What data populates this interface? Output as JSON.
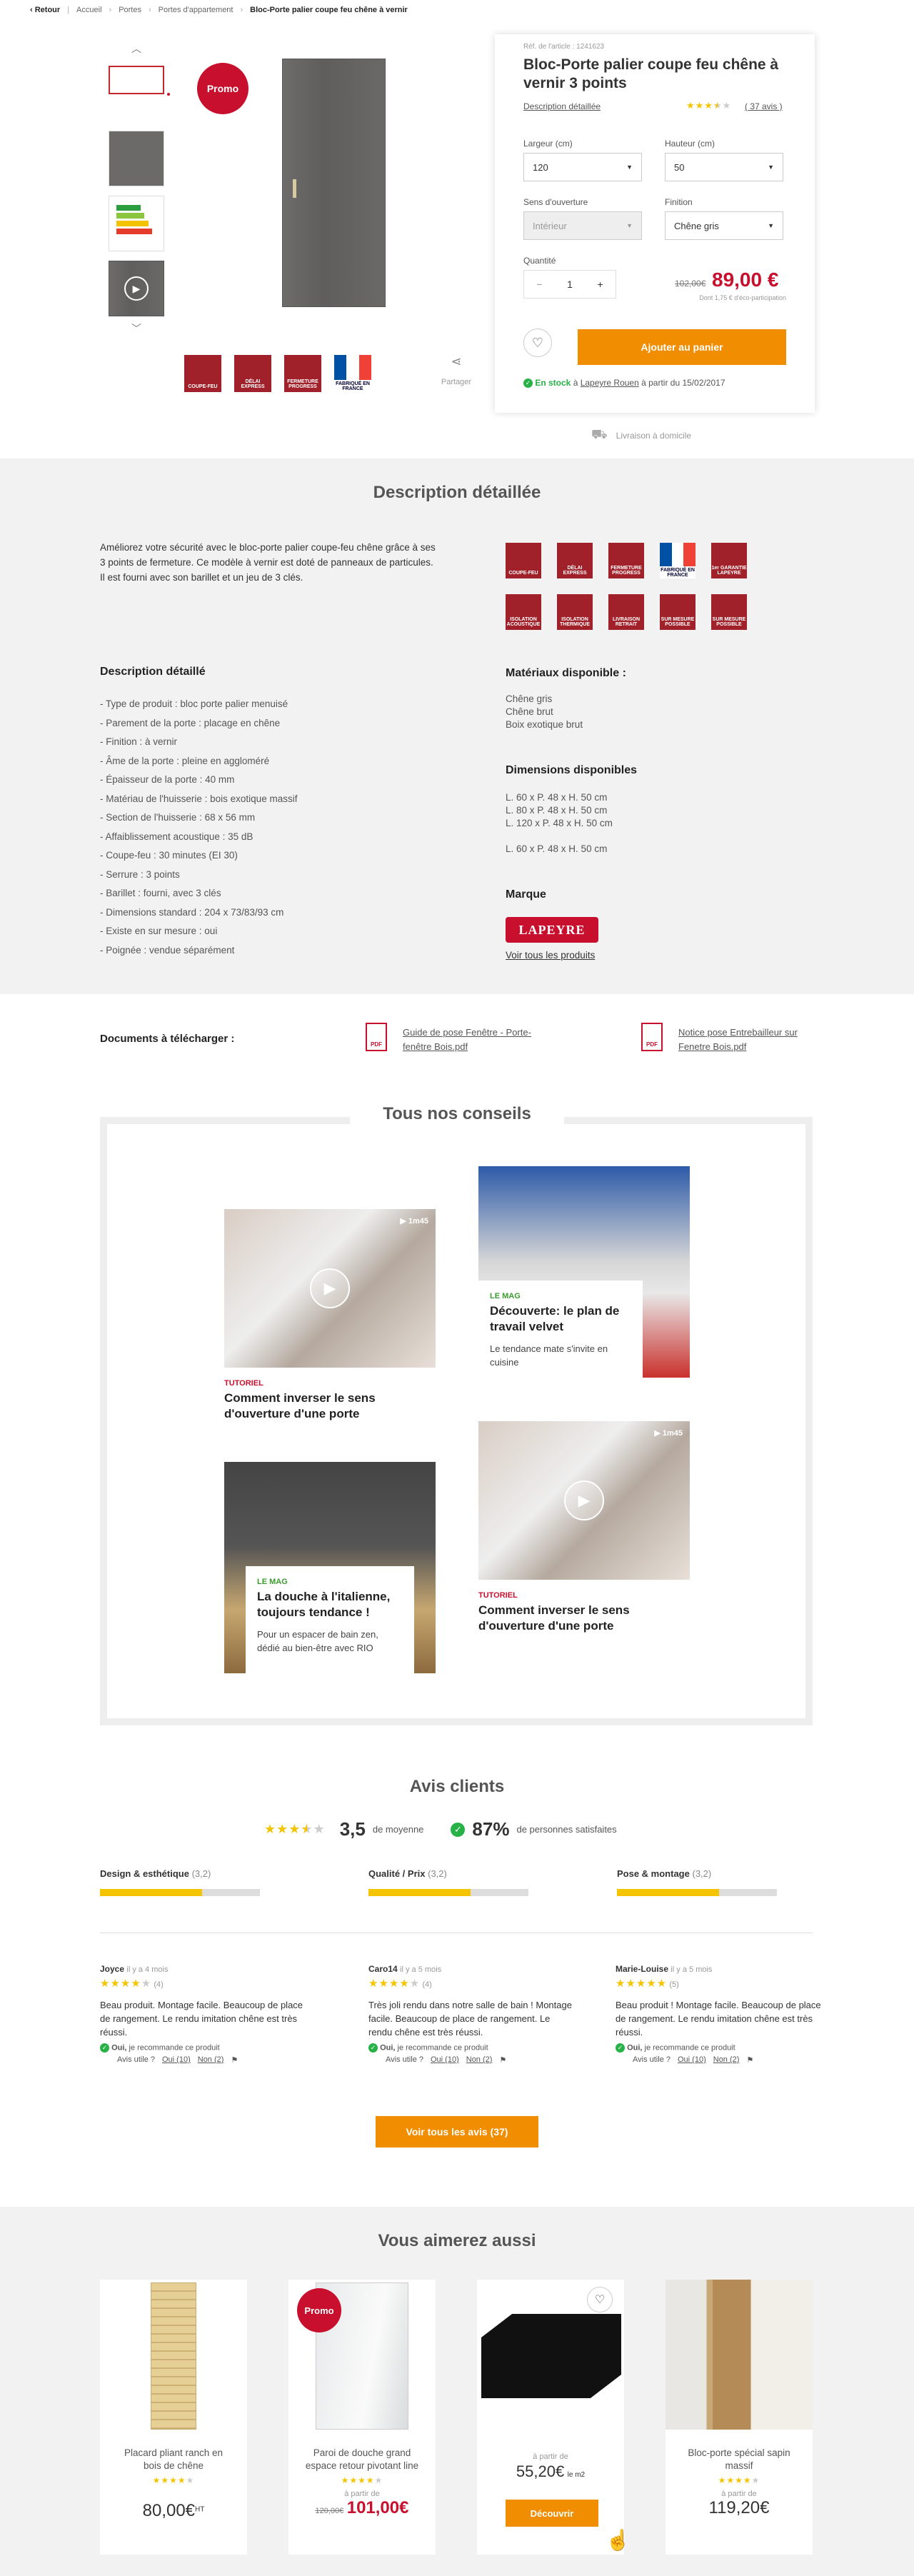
{
  "breadcrumb": {
    "back": "Retour",
    "items": [
      "Accueil",
      "Portes",
      "Portes d'appartement"
    ],
    "current": "Bloc-Porte palier coupe feu chêne à vernir"
  },
  "gallery": {
    "promo": "Promo",
    "share": "Partager",
    "badges": [
      "COUPE-FEU",
      "DÉLAI EXPRESS",
      "FERMETURE PROGRESS",
      "FABRIQUÉ EN FRANCE"
    ]
  },
  "product": {
    "ref": "Réf. de l'article : 1241623",
    "title": "Bloc-Porte palier coupe feu chêne à vernir 3 points",
    "desc_link": "Description détaillée",
    "rating": 3.5,
    "reviews_link": "( 37 avis )",
    "largeur_label": "Largeur (cm)",
    "largeur_value": "120",
    "hauteur_label": "Hauteur (cm)",
    "hauteur_value": "50",
    "sens_label": "Sens d'ouverture",
    "sens_value": "Intérieur",
    "finition_label": "Finition",
    "finition_value": "Chêne gris",
    "qty_label": "Quantité",
    "qty_value": "1",
    "minus": "−",
    "plus": "+",
    "old_price": "102,00€",
    "price": "89,00 €",
    "eco": "Dont 1,75 € d'éco-participation",
    "add_cart": "Ajouter au panier",
    "stock_bold": "En stock",
    "stock_a": " à ",
    "stock_store": "Lapeyre Rouen",
    "stock_rest": " à partir du 15/02/2017",
    "delivery": "Livraison à domicile"
  },
  "description": {
    "title": "Description détaillée",
    "intro": "Améliorez votre sécurité avec le bloc-porte palier coupe-feu chêne grâce à ses 3 points de fermeture. Ce modèle à vernir est doté de panneaux de particules. Il est fourni avec son barillet et un jeu de 3 clés.",
    "icons": [
      "COUPE-FEU",
      "DÉLAI EXPRESS",
      "FERMETURE PROGRESS",
      "FABRIQUÉ EN FRANCE",
      "1er GARANTIE LAPEYRE",
      "ISOLATION ACOUSTIQUE",
      "ISOLATION THERMIQUE",
      "LIVRAISON RETRAIT",
      "SUR MESURE POSSIBLE",
      "SUR MESURE POSSIBLE"
    ],
    "list_title": "Description détaillé",
    "list": [
      "- Type de produit : bloc porte palier menuisé",
      "- Parement de la porte : placage en chêne",
      "- Finition : à vernir",
      "- Âme de la porte : pleine en aggloméré",
      "- Épaisseur de la porte : 40 mm",
      "- Matériau de l'huisserie : bois exotique massif",
      "- Section de l'huisserie : 68 x 56 mm",
      "- Affaiblissement acoustique : 35 dB",
      "- Coupe-feu : 30 minutes (EI 30)",
      "- Serrure : 3 points",
      "- Barillet : fourni, avec 3 clés",
      "- Dimensions standard : 204 x 73/83/93 cm",
      "- Existe en sur mesure : oui",
      "- Poignée : vendue séparément"
    ],
    "materials_title": "Matériaux disponible :",
    "materials": [
      "Chêne gris",
      "Chêne brut",
      "Boix exotique brut"
    ],
    "dims_title": "Dimensions disponibles",
    "dims": [
      "L. 60 x P. 48 x H. 50 cm",
      "L. 80 x P. 48 x H. 50 cm",
      "L. 120 x P. 48 x H. 50 cm"
    ],
    "dims_extra": "L. 60 x P. 48 x H. 50 cm",
    "brand_title": "Marque",
    "brand_logo": "LAPEYRE",
    "brand_link": "Voir tous les produits"
  },
  "documents": {
    "title": "Documents à télécharger :",
    "items": [
      "Guide de pose Fenêtre - Porte-fenêtre Bois.pdf",
      "Notice pose Entrebailleur sur Fenetre Bois.pdf"
    ],
    "pdf": "PDF"
  },
  "conseils": {
    "title": "Tous nos conseils",
    "cards": [
      {
        "tag": "TUTORIEL",
        "title": "Comment inverser le sens d'ouverture d'une porte",
        "duration": "1m45"
      },
      {
        "tag": "LE MAG",
        "title": "Découverte: le plan de travail velvet",
        "sub": "Le tendance mate s'invite en cuisine"
      },
      {
        "tag": "LE MAG",
        "title": "La douche à l'italienne, toujours tendance !",
        "sub": "Pour un espacer de bain zen, dédié au bien-être avec RIO"
      },
      {
        "tag": "TUTORIEL",
        "title": "Comment inverser le sens d'ouverture d'une porte",
        "duration": "1m45"
      }
    ]
  },
  "reviews": {
    "title": "Avis clients",
    "avg": "3,5",
    "avg_label": "de moyenne",
    "pct": "87%",
    "pct_label": "de personnes satisfaites",
    "criteria": [
      {
        "name": "Design & esthétique",
        "score": "(3,2)",
        "fill": 0.64
      },
      {
        "name": "Qualité / Prix",
        "score": "(3,2)",
        "fill": 0.64
      },
      {
        "name": "Pose & montage",
        "score": "(3,2)",
        "fill": 0.64
      }
    ],
    "items": [
      {
        "name": "Joyce",
        "when": "il y a 4 mois",
        "count": "(4)",
        "text": "Beau produit. Montage facile. Beaucoup de place de rangement. Le rendu imitation chêne est très réussi."
      },
      {
        "name": "Caro14",
        "when": "il y a 5 mois",
        "count": "(4)",
        "text": "Très joli rendu dans notre salle de bain ! Montage facile. Beaucoup de place de rangement. Le rendu chêne est très réussi."
      },
      {
        "name": "Marie-Louise",
        "when": "il y a 5 mois",
        "count": "(5)",
        "text": "Beau produit ! Montage facile. Beaucoup de place de rangement. Le rendu imitation chêne est très réussi."
      }
    ],
    "recommend_bold": "Oui,",
    "recommend": " je recommande ce produit",
    "useful": "Avis utile ?",
    "yes": "Oui (10)",
    "no": "Non (2)",
    "all_button": "Voir tous les avis (37)"
  },
  "related": {
    "title": "Vous aimerez aussi",
    "items": [
      {
        "name": "Placard pliant ranch en bois de chêne",
        "price": "80,00€",
        "sup": "HT"
      },
      {
        "name": "Paroi de douche grand espace retour pivotant line",
        "from": "à partir de",
        "old": "120,00€",
        "price": "101,00€",
        "promo": "Promo"
      },
      {
        "from": "à partir de",
        "price": "55,20€",
        "unit": "le m2",
        "button": "Découvrir"
      },
      {
        "name": "Bloc-porte spécial sapin massif",
        "from": "à partir de",
        "price": "119,20€"
      }
    ]
  }
}
